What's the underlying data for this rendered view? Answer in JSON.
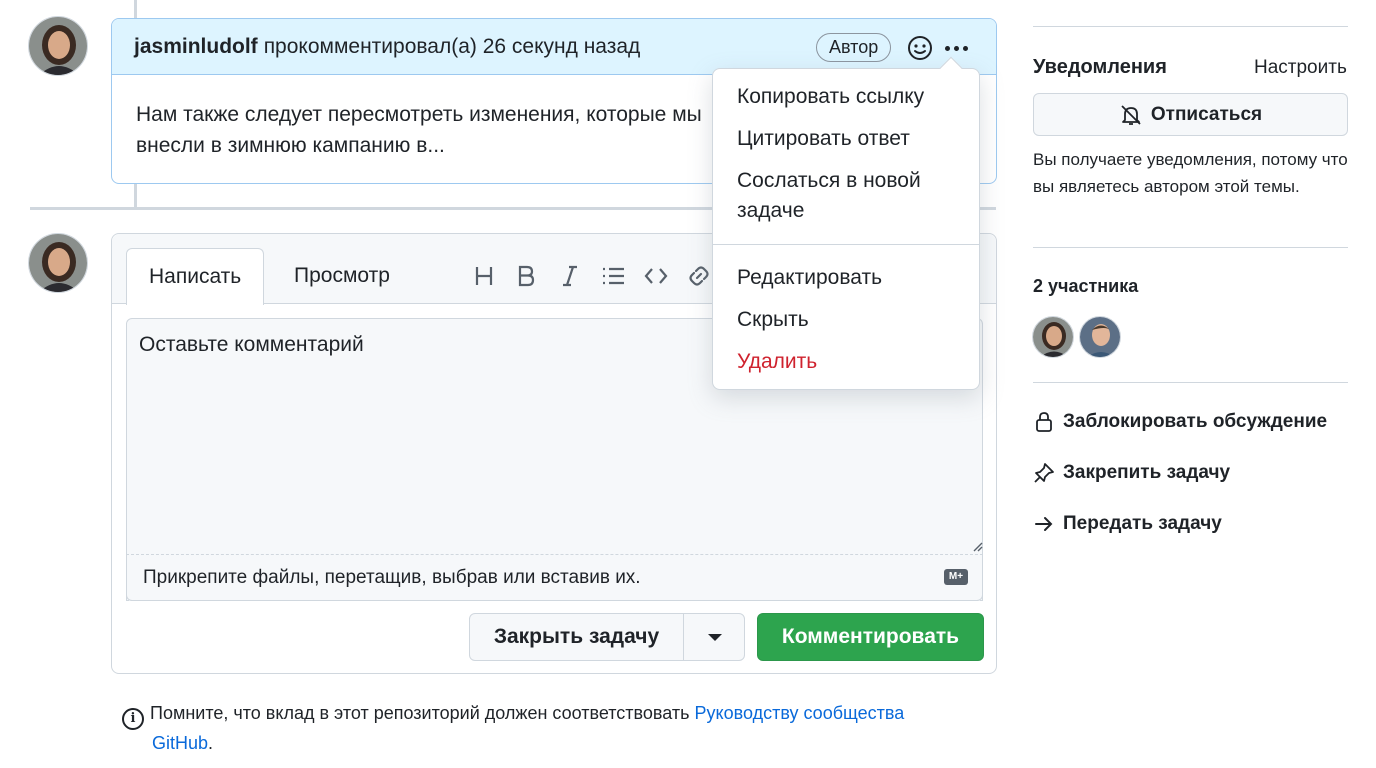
{
  "comment": {
    "author": "jasminludolf",
    "meta": "прокомментировал(а) 26 секунд назад",
    "badge": "Автор",
    "body": "Нам также следует пересмотреть изменения, которые мы внесли в зимнюю кампанию в..."
  },
  "menu": {
    "items": [
      "Копировать ссылку",
      "Цитировать ответ",
      "Сослаться в новой задаче",
      "Редактировать",
      "Скрыть",
      "Удалить"
    ]
  },
  "editor": {
    "tabs": [
      "Написать",
      "Просмотр"
    ],
    "toolbar_icons": [
      "heading-icon",
      "bold-icon",
      "italic-icon",
      "list-icon",
      "code-icon",
      "link-icon"
    ],
    "placeholder": "Оставьте комментарий",
    "attach_hint": "Прикрепите файлы, перетащив, выбрав или вставив их.",
    "md_badge": "M+",
    "close_button": "Закрыть задачу",
    "comment_button": "Комментировать"
  },
  "note": {
    "text": "Помните, что вклад в этот репозиторий должен соответствовать ",
    "link": "Руководству сообщества",
    "link_cont": "GitHub",
    "end": "."
  },
  "sidebar": {
    "notifications_title": "Уведомления",
    "customize_link": "Настроить",
    "unsubscribe_button": "Отписаться",
    "notification_reason": "Вы получаете уведомления, потому что вы являетесь автором этой темы.",
    "participants_title": "2 участника",
    "actions": [
      "Заблокировать обсуждение",
      "Закрепить задачу",
      "Передать задачу"
    ]
  },
  "colors": {
    "accent_green": "#2da44e",
    "header_blue": "#ddf4ff",
    "danger_red": "#cf222e",
    "link_blue": "#0969da"
  }
}
